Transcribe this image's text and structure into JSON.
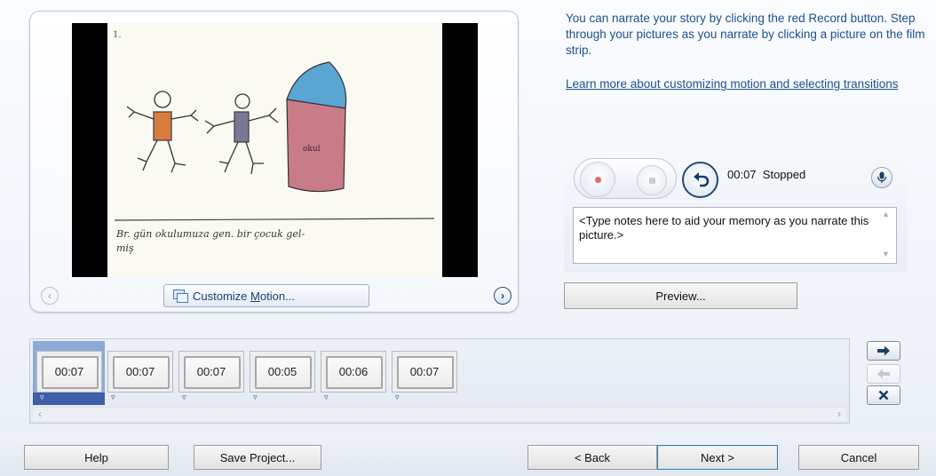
{
  "preview": {
    "photo_caption_number": "1.",
    "handwriting_line1": "Br. gün okulumuza  gen.  bir çocuk gel-",
    "handwriting_line2": "miş",
    "building_text": "okul",
    "customize_motion_label_pre": "Customize ",
    "customize_motion_label_access": "M",
    "customize_motion_label_post": "otion...",
    "prev_arrow_icon": "chevron-left-icon",
    "next_arrow_icon": "chevron-right-icon"
  },
  "instructions": {
    "text": "You can narrate your story by clicking the red Record button. Step through your pictures as you narrate by clicking a picture on the film strip.",
    "learn_more_link": "Learn more about customizing motion and selecting transitions"
  },
  "narration": {
    "time": "00:07",
    "status": "Stopped",
    "notes_text": "<Type notes here to aid your memory as you narrate this picture.>",
    "preview_button": "Preview...",
    "record_color": "#e46a6a"
  },
  "filmstrip": {
    "thumbnails": [
      {
        "duration": "00:07",
        "selected": true,
        "has_notes": true
      },
      {
        "duration": "00:07",
        "selected": false,
        "has_notes": true
      },
      {
        "duration": "00:07",
        "selected": false,
        "has_notes": true
      },
      {
        "duration": "00:05",
        "selected": false,
        "has_notes": true
      },
      {
        "duration": "00:06",
        "selected": false,
        "has_notes": true
      },
      {
        "duration": "00:07",
        "selected": false,
        "has_notes": true
      }
    ],
    "selection_color": "#3c5fa8"
  },
  "footer": {
    "help": "Help",
    "save_project": "Save Project...",
    "back": "< Back",
    "next": "Next >",
    "cancel": "Cancel"
  }
}
